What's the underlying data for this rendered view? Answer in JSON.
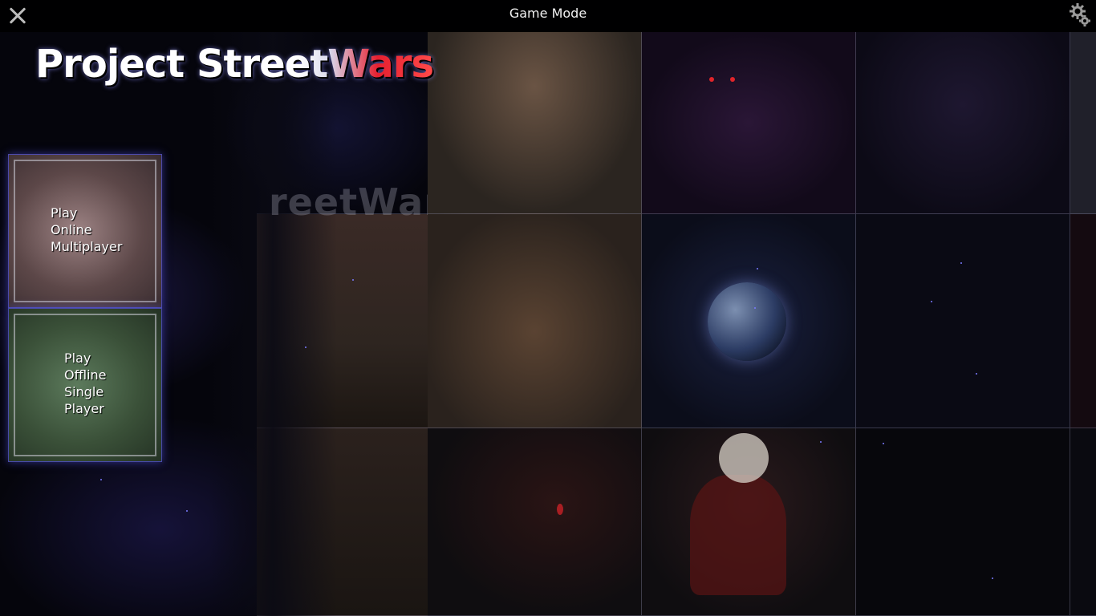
{
  "header": {
    "title": "Game Mode",
    "close_icon": "close-icon",
    "settings_icon": "gear-icon"
  },
  "logo": {
    "text": "Project StreetWars"
  },
  "watermark": {
    "text": "reetWar"
  },
  "modes": {
    "online": {
      "lines": [
        "Play",
        "Online",
        "Multiplayer"
      ]
    },
    "offline": {
      "lines": [
        "Play",
        "Offline",
        "Single",
        "Player"
      ]
    }
  },
  "colors": {
    "accent_glow": "#5a5aff",
    "online_tile": "#7a6263",
    "offline_tile": "#3f573e",
    "logo_red": "#e62030"
  }
}
